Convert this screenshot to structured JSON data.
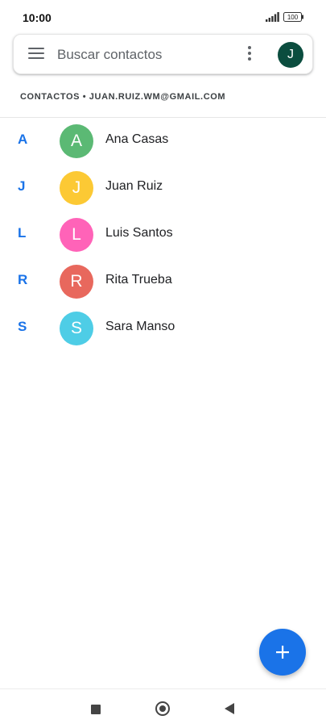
{
  "status_bar": {
    "time": "10:00",
    "battery": "100"
  },
  "search_bar": {
    "placeholder": "Buscar contactos",
    "account_initial": "J"
  },
  "account_header": "CONTACTOS • JUAN.RUIZ.WM@GMAIL.COM",
  "contacts": [
    {
      "letter": "A",
      "initial": "A",
      "name": "Ana Casas",
      "color": "#5bb974"
    },
    {
      "letter": "J",
      "initial": "J",
      "name": "Juan Ruiz",
      "color": "#fcc934"
    },
    {
      "letter": "L",
      "initial": "L",
      "name": "Luis Santos",
      "color": "#ff63b8"
    },
    {
      "letter": "R",
      "initial": "R",
      "name": "Rita Trueba",
      "color": "#e8685d"
    },
    {
      "letter": "S",
      "initial": "S",
      "name": "Sara Manso",
      "color": "#4ecde6"
    }
  ],
  "colors": {
    "accent": "#1a73e8",
    "account_avatar": "#0b4d3f"
  },
  "icons": {
    "menu": "menu-icon",
    "more": "more-vert-icon",
    "fab": "plus-icon",
    "nav_recents": "square-icon",
    "nav_home": "circle-icon",
    "nav_back": "triangle-back-icon"
  }
}
